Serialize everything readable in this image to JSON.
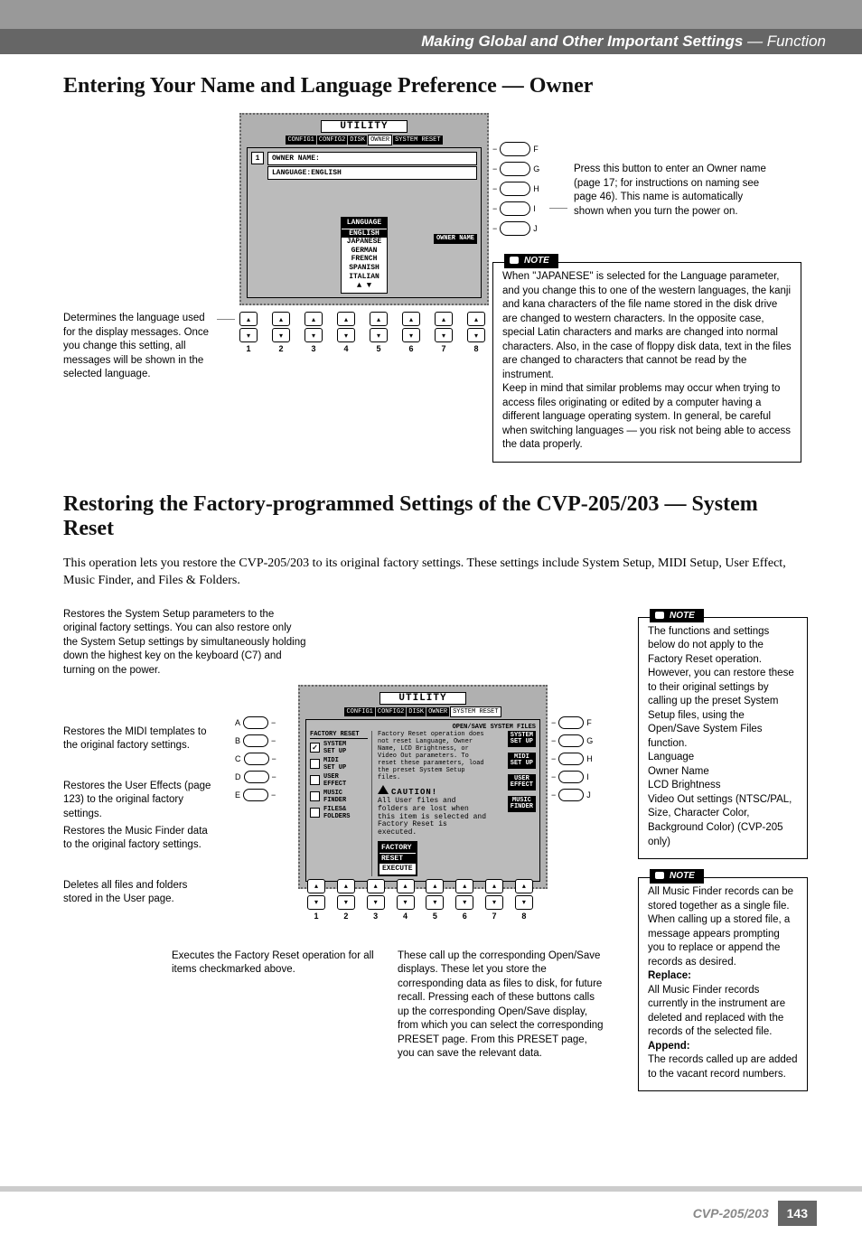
{
  "header": {
    "title_main": "Making Global and Other Important Settings",
    "title_sub": "— Function"
  },
  "section1": {
    "heading": "Entering Your Name and Language Preference — Owner",
    "left_annot": "Determines the language used for the display messages. Once you change this setting, all messages will be shown in the selected language.",
    "right_annot": "Press this button to enter an Owner name (page 17; for instructions on naming see page 46). This name is automatically shown when you turn the power on.",
    "note_label": "NOTE",
    "note_text": "When \"JAPANESE\" is selected for the Language parameter, and you change this to one of the western languages, the kanji and kana characters of the file name stored in the disk drive are changed to western characters. In the opposite case, special Latin characters and marks are changed into normal characters. Also, in the case of floppy disk data, text in the files are changed to characters that cannot be read by the instrument.\nKeep in mind that similar problems may occur when trying to access files originating or edited by a computer having a different language operating system. In general, be careful when switching languages — you risk not being able to access the data properly.",
    "lcd": {
      "title": "UTILITY",
      "tabs": [
        "CONFIG1",
        "CONFIG2",
        "DISK",
        "OWNER",
        "SYSTEM RESET"
      ],
      "selected_tab": 3,
      "owner_name_label": "OWNER NAME:",
      "language_label": "LANGUAGE:ENGLISH",
      "right_btn": "OWNER\nNAME",
      "lang_header": "LANGUAGE",
      "languages": [
        "ENGLISH",
        "JAPANESE",
        "GERMAN",
        "FRENCH",
        "SPANISH",
        "ITALIAN"
      ],
      "selected_language": 0,
      "side_labels_right": [
        "F",
        "G",
        "H",
        "I",
        "J"
      ],
      "bottom_numbers": [
        "1",
        "2",
        "3",
        "4",
        "5",
        "6",
        "7",
        "8"
      ]
    }
  },
  "section2": {
    "heading": "Restoring the Factory-programmed Settings of the CVP-205/203 — System Reset",
    "intro": "This operation lets you restore the CVP-205/203 to its original factory settings. These settings include System Setup, MIDI Setup, User Effect, Music Finder, and Files & Folders.",
    "annotations": {
      "a1": "Restores the System Setup parameters to the original factory settings. You can also restore only the System Setup settings by simultaneously holding down the highest key on the keyboard (C7) and turning on the power.",
      "a2": "Restores the MIDI templates to the original factory settings.",
      "a3": "Restores the User Effects (page 123) to the original factory settings.",
      "a4": "Restores the Music Finder data to the original factory settings.",
      "a5": "Deletes all files and folders stored in the User page.",
      "a6": "Executes the Factory Reset operation for all items checkmarked above.",
      "a7": "These call up the corresponding Open/Save displays. These let you store the corresponding data as files to disk, for future recall. Pressing each of these buttons calls up the corresponding Open/Save display, from which you can select the corresponding PRESET page. From this PRESET page, you can save the relevant data."
    },
    "note1_label": "NOTE",
    "note1_text": "The functions and settings below do not apply to the Factory Reset operation. However, you can restore these to their original settings by calling up the preset System Setup files, using the Open/Save System Files function.\nLanguage\nOwner Name\nLCD Brightness\nVideo Out settings (NTSC/PAL, Size, Character Color, Background Color) (CVP-205 only)",
    "note2_label": "NOTE",
    "note2_text": "All Music Finder records can be stored together as a single file. When calling up a stored file, a message appears prompting you to replace or append the records as desired.",
    "note2_replace_h": "Replace:",
    "note2_replace": "All Music Finder records currently in the instrument are deleted and replaced with the records of the selected file.",
    "note2_append_h": "Append:",
    "note2_append": "The records called up are added to the vacant record numbers.",
    "lcd": {
      "title": "UTILITY",
      "tabs": [
        "CONFIG1",
        "CONFIG2",
        "DISK",
        "OWNER",
        "SYSTEM RESET"
      ],
      "selected_tab": 4,
      "subheader": "OPEN/SAVE SYSTEM FILES",
      "left_header": "FACTORY RESET",
      "items": [
        {
          "label": "SYSTEM\nSET UP",
          "checked": true
        },
        {
          "label": "MIDI\nSET UP",
          "checked": false
        },
        {
          "label": "USER\nEFFECT",
          "checked": false
        },
        {
          "label": "MUSIC\nFINDER",
          "checked": false
        },
        {
          "label": "FILES&\nFOLDERS",
          "checked": false
        }
      ],
      "right_items": [
        "SYSTEM\nSET UP",
        "MIDI\nSET UP",
        "USER\nEFFECT",
        "MUSIC\nFINDER"
      ],
      "desc": "Factory Reset operation does not reset Language, Owner Name, LCD Brightness, or Video Out parameters. To reset these parameters, load the preset System Setup files.",
      "caution_h": "CAUTION!",
      "caution": "All User files and folders are lost when this item is selected and Factory Reset is executed.",
      "exec_btn1": "FACTORY",
      "exec_btn2": "RESET",
      "exec_btn3": "EXECUTE",
      "side_left": [
        "A",
        "B",
        "C",
        "D",
        "E"
      ],
      "side_right": [
        "F",
        "G",
        "H",
        "I",
        "J"
      ],
      "bottom_numbers": [
        "1",
        "2",
        "3",
        "4",
        "5",
        "6",
        "7",
        "8"
      ]
    }
  },
  "footer": {
    "model": "CVP-205/203",
    "page": "143"
  }
}
